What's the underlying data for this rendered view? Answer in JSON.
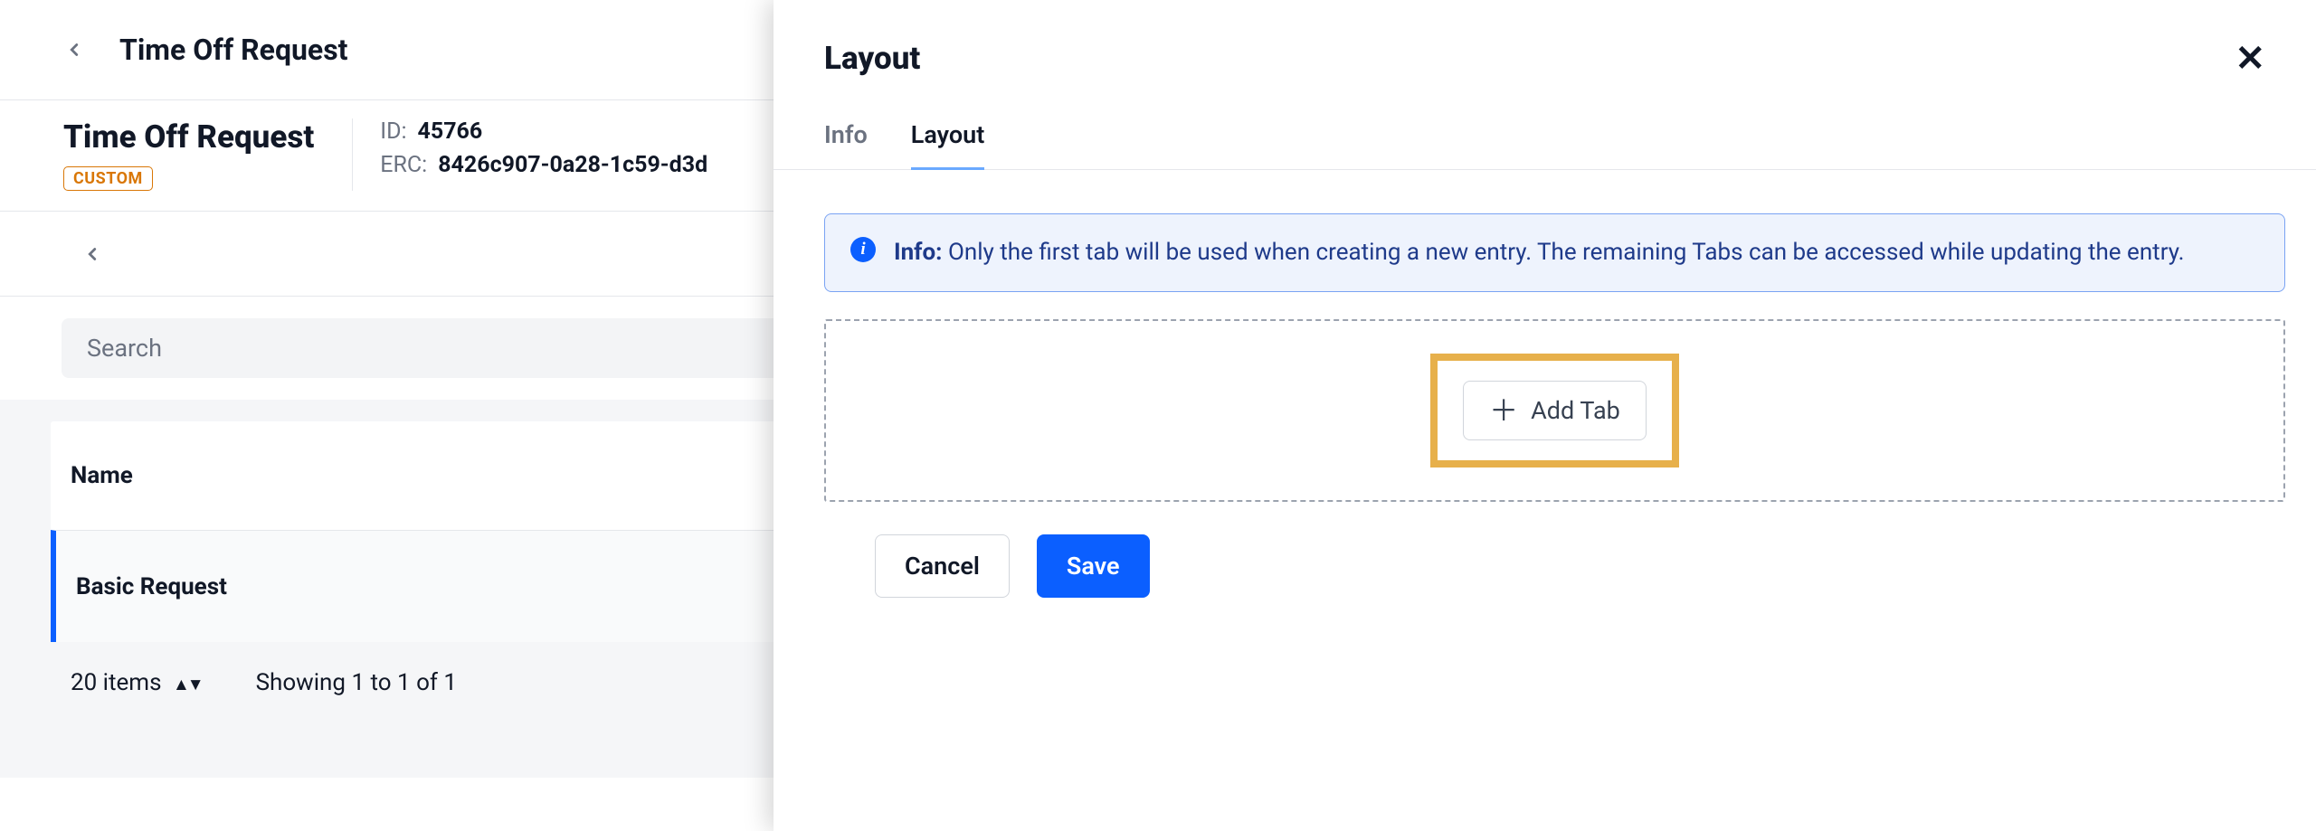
{
  "topbar": {
    "title": "Time Off Request"
  },
  "record": {
    "title": "Time Off Request",
    "badge": "CUSTOM",
    "id_label": "ID:",
    "id_value": "45766",
    "erc_label": "ERC:",
    "erc_value": "8426c907-0a28-1c59-d3d"
  },
  "search": {
    "placeholder": "Search"
  },
  "table": {
    "col_name": "Name",
    "rows": [
      {
        "name": "Basic Request"
      }
    ]
  },
  "pager": {
    "items": "20 items",
    "showing": "Showing 1 to 1 of 1"
  },
  "panel": {
    "title": "Layout",
    "tabs": {
      "info": "Info",
      "layout": "Layout"
    },
    "alert_label": "Info:",
    "alert_text": "Only the first tab will be used when creating a new entry. The remaining Tabs can be accessed while updating the entry.",
    "add_tab": "Add Tab",
    "cancel": "Cancel",
    "save": "Save"
  }
}
